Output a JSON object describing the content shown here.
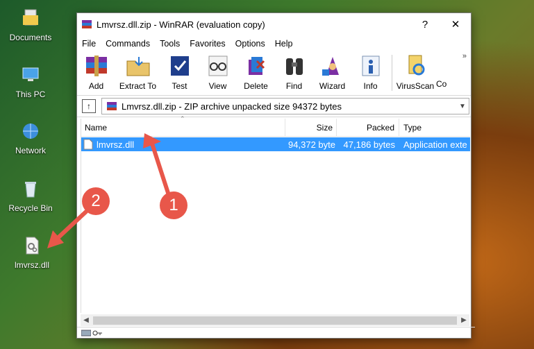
{
  "desktop": {
    "icons": [
      {
        "label": "Documents",
        "icon": "folder-icon"
      },
      {
        "label": "This PC",
        "icon": "computer-icon"
      },
      {
        "label": "Network",
        "icon": "network-icon"
      },
      {
        "label": "Recycle Bin",
        "icon": "recycle-bin-icon"
      },
      {
        "label": "lmvrsz.dll",
        "icon": "dll-file-icon"
      }
    ]
  },
  "window": {
    "title": "Lmvrsz.dll.zip - WinRAR (evaluation copy)",
    "help_button": "?",
    "close_button": "✕"
  },
  "menubar": [
    "File",
    "Commands",
    "Tools",
    "Favorites",
    "Options",
    "Help"
  ],
  "toolbar": {
    "buttons": [
      {
        "label": "Add",
        "icon": "add-books-icon"
      },
      {
        "label": "Extract To",
        "icon": "extract-folder-icon"
      },
      {
        "label": "Test",
        "icon": "test-check-icon"
      },
      {
        "label": "View",
        "icon": "view-glasses-icon"
      },
      {
        "label": "Delete",
        "icon": "delete-icon"
      },
      {
        "label": "Find",
        "icon": "binoculars-icon"
      },
      {
        "label": "Wizard",
        "icon": "wizard-icon"
      },
      {
        "label": "Info",
        "icon": "info-icon"
      },
      {
        "label": "VirusScan",
        "icon": "virusscan-icon"
      },
      {
        "label": "Co",
        "icon": "comment-icon"
      }
    ],
    "overflow": "»"
  },
  "pathbar": {
    "path": "Lmvrsz.dll.zip - ZIP archive unpacked size 94372 bytes"
  },
  "filelist": {
    "columns": [
      "Name",
      "Size",
      "Packed",
      "Type"
    ],
    "rows": [
      {
        "name": "lmvrsz.dll",
        "size": "94,372 byte",
        "packed": "47,186 bytes",
        "type": "Application exte"
      }
    ]
  },
  "callouts": [
    "1",
    "2"
  ],
  "colors": {
    "selection": "#3399ff",
    "callout": "#e8574a"
  }
}
